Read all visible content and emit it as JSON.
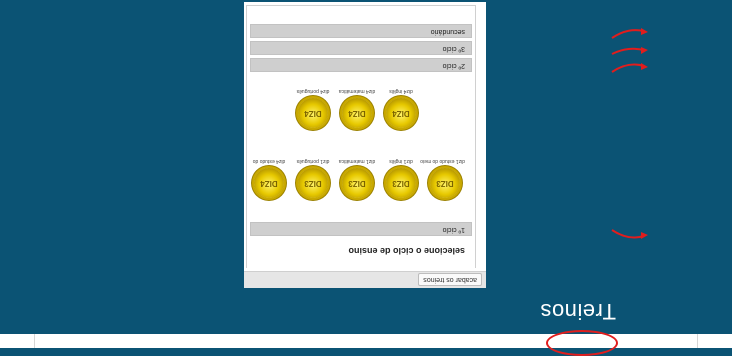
{
  "page_title": "Treinos",
  "back_button": "acabar os treinos",
  "heading": "selecione o ciclo de ensino",
  "cycles": {
    "first": "1º ciclo",
    "second": "2º ciclo",
    "third": "3º ciclo",
    "secondary": "secundário"
  },
  "first_cycle_medals": [
    {
      "coin": "DIZ3",
      "label": "diz1 estudo do meio"
    },
    {
      "coin": "DIZ3",
      "label": "diz1 inglês"
    },
    {
      "coin": "DIZ3",
      "label": "diz1 matemática"
    },
    {
      "coin": "DIZ3",
      "label": "diz1 português"
    },
    {
      "coin": "DIZ4",
      "label": "diz4 estudo do"
    }
  ],
  "second_cycle_medals": [
    {
      "coin": "DIZ4",
      "label": "diz4 inglês"
    },
    {
      "coin": "DIZ4",
      "label": "diz4 matemática"
    },
    {
      "coin": "DIZ4",
      "label": "diz4 português"
    }
  ],
  "colors": {
    "background": "#0b5374",
    "annotation": "#e11d1d",
    "coin": "#e7c900"
  },
  "icons": [
    "arrow-annotation-icon",
    "medal-coin-icon"
  ]
}
